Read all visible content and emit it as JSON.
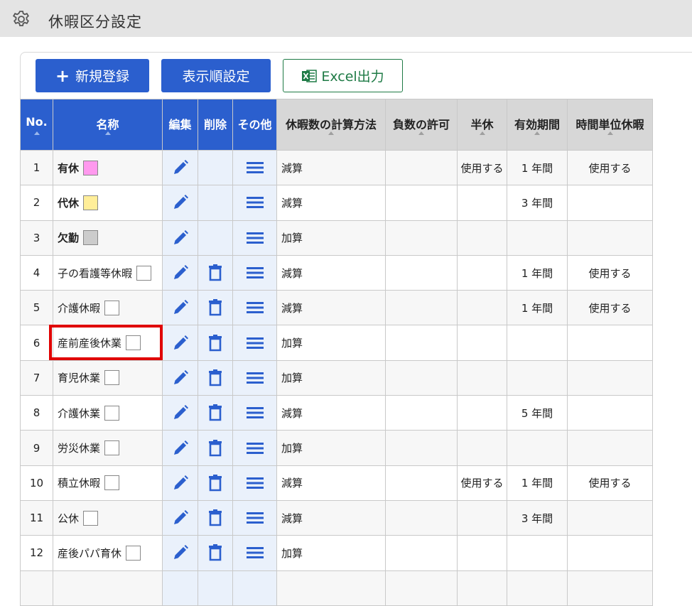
{
  "header": {
    "title": "休暇区分設定",
    "icon": "gear-icon"
  },
  "toolbar": {
    "new_label": "新規登録",
    "order_label": "表示順設定",
    "excel_label": "Excel出力"
  },
  "columns": [
    "No.",
    "名称",
    "編集",
    "削除",
    "その他",
    "休暇数の計算方法",
    "負数の許可",
    "半休",
    "有効期間",
    "時間単位休暇"
  ],
  "colors": {
    "primary": "#2b5fce",
    "excel_green": "#1e7a45",
    "highlight": "#e00000"
  },
  "rows": [
    {
      "no": "1",
      "name": "有休",
      "bold": true,
      "color": "#ff99ee",
      "deletable": false,
      "calc": "減算",
      "negative": "",
      "half": "使用する",
      "period": "1 年間",
      "hourly": "使用する"
    },
    {
      "no": "2",
      "name": "代休",
      "bold": true,
      "color": "#ffee99",
      "deletable": false,
      "calc": "減算",
      "negative": "",
      "half": "",
      "period": "3 年間",
      "hourly": ""
    },
    {
      "no": "3",
      "name": "欠勤",
      "bold": true,
      "color": "#cccccc",
      "deletable": false,
      "calc": "加算",
      "negative": "",
      "half": "",
      "period": "",
      "hourly": ""
    },
    {
      "no": "4",
      "name": "子の看護等休暇",
      "bold": false,
      "color": "#ffffff",
      "deletable": true,
      "calc": "減算",
      "negative": "",
      "half": "",
      "period": "1 年間",
      "hourly": "使用する"
    },
    {
      "no": "5",
      "name": "介護休暇",
      "bold": false,
      "color": "#ffffff",
      "deletable": true,
      "calc": "減算",
      "negative": "",
      "half": "",
      "period": "1 年間",
      "hourly": "使用する"
    },
    {
      "no": "6",
      "name": "産前産後休業",
      "bold": false,
      "color": "#ffffff",
      "deletable": true,
      "calc": "加算",
      "negative": "",
      "half": "",
      "period": "",
      "hourly": ""
    },
    {
      "no": "7",
      "name": "育児休業",
      "bold": false,
      "color": "#ffffff",
      "deletable": true,
      "calc": "加算",
      "negative": "",
      "half": "",
      "period": "",
      "hourly": ""
    },
    {
      "no": "8",
      "name": "介護休業",
      "bold": false,
      "color": "#ffffff",
      "deletable": true,
      "calc": "減算",
      "negative": "",
      "half": "",
      "period": "5 年間",
      "hourly": ""
    },
    {
      "no": "9",
      "name": "労災休業",
      "bold": false,
      "color": "#ffffff",
      "deletable": true,
      "calc": "加算",
      "negative": "",
      "half": "",
      "period": "",
      "hourly": ""
    },
    {
      "no": "10",
      "name": "積立休暇",
      "bold": false,
      "color": "#ffffff",
      "deletable": true,
      "calc": "減算",
      "negative": "",
      "half": "使用する",
      "period": "1 年間",
      "hourly": "使用する"
    },
    {
      "no": "11",
      "name": "公休",
      "bold": false,
      "color": "#ffffff",
      "deletable": true,
      "calc": "減算",
      "negative": "",
      "half": "",
      "period": "3 年間",
      "hourly": ""
    },
    {
      "no": "12",
      "name": "産後パパ育休",
      "bold": false,
      "color": "#ffffff",
      "deletable": true,
      "calc": "加算",
      "negative": "",
      "half": "",
      "period": "",
      "hourly": ""
    },
    {
      "no": "",
      "name": "",
      "bold": false,
      "color": "",
      "deletable": false,
      "calc": "",
      "negative": "",
      "half": "",
      "period": "",
      "hourly": ""
    }
  ]
}
